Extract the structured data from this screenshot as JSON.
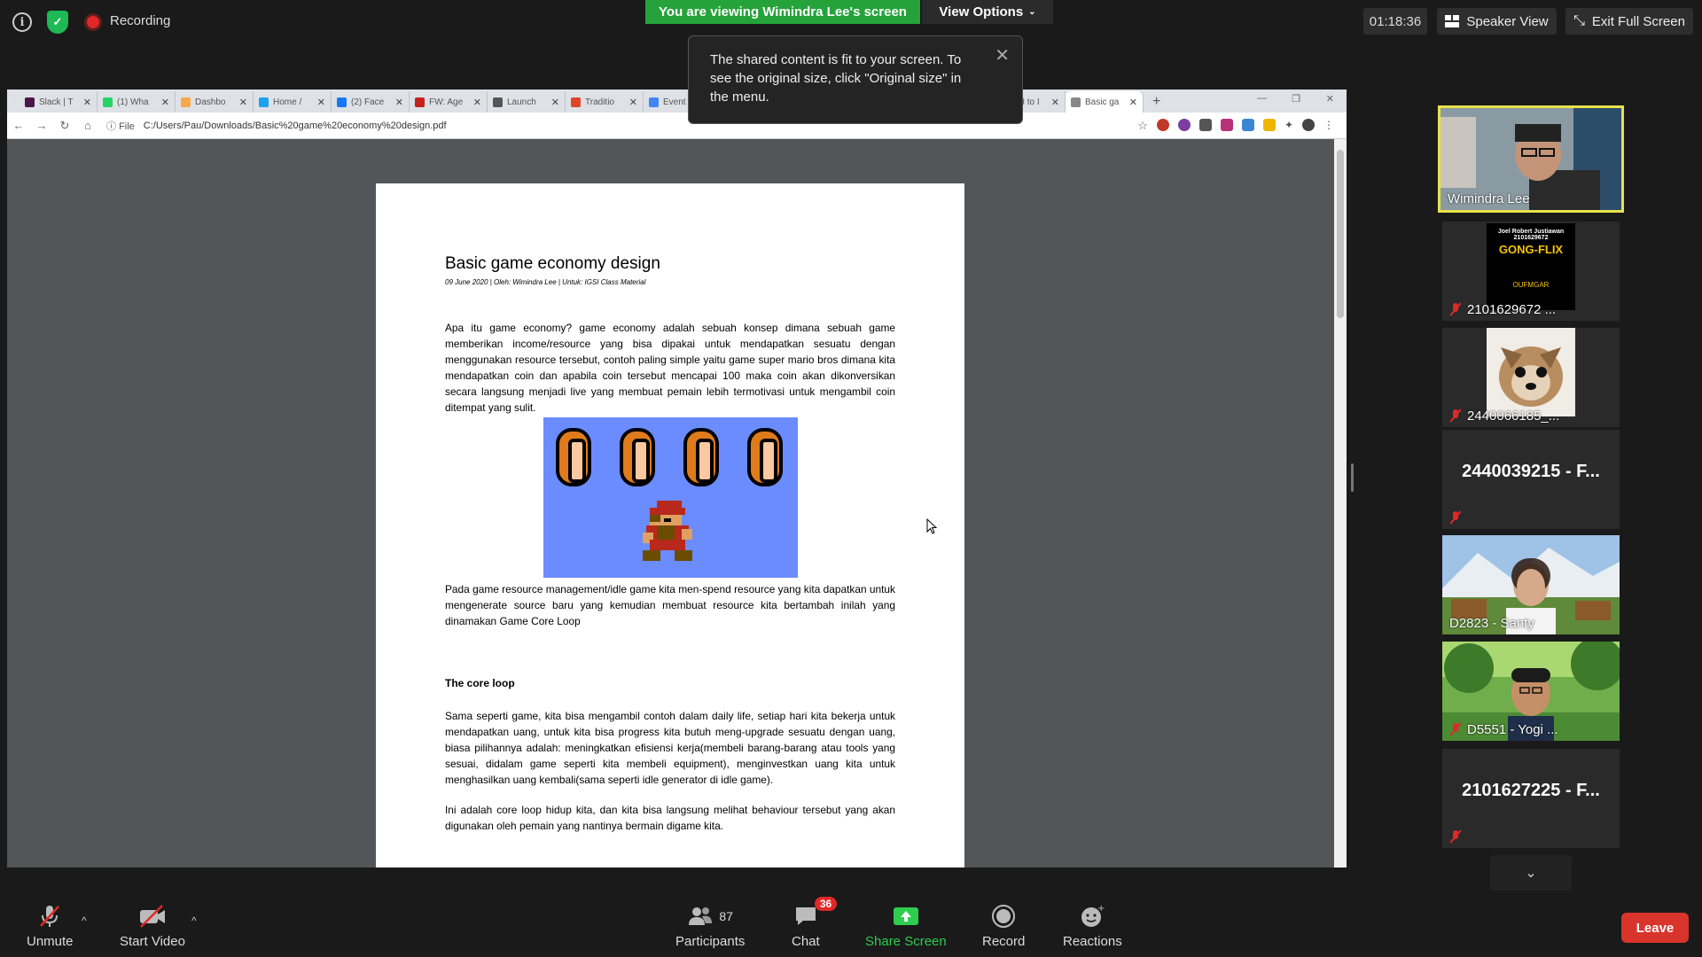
{
  "topbar": {
    "recording_label": "Recording",
    "viewing_banner": "You are viewing Wimindra Lee's screen",
    "view_options_label": "View Options",
    "timer": "01:18:36",
    "speaker_view_label": "Speaker View",
    "exit_fullscreen_label": "Exit Full Screen"
  },
  "tooltip": {
    "text": "The shared content is fit to your screen. To see the original size, click \"Original size\" in the menu."
  },
  "browser": {
    "tabs": [
      {
        "label": "Slack | T",
        "color": "#4a154b"
      },
      {
        "label": "(1) Wha",
        "color": "#25d366"
      },
      {
        "label": "Dashbo",
        "color": "#f7a94a"
      },
      {
        "label": "Home /",
        "color": "#1da1f2"
      },
      {
        "label": "(2) Face",
        "color": "#1877f2"
      },
      {
        "label": "FW: Age",
        "color": "#c5221f"
      },
      {
        "label": "Launch",
        "color": "#555555"
      },
      {
        "label": "Traditio",
        "color": "#e0452b"
      },
      {
        "label": "Event",
        "color": "#4285f4"
      },
      {
        "label": "ETH to I",
        "color": "#2c6ecb"
      },
      {
        "label": "Basic ga",
        "color": "#888888"
      }
    ],
    "address_scheme": "File",
    "address_url": "C:/Users/Pau/Downloads/Basic%20game%20economy%20design.pdf"
  },
  "document": {
    "title": "Basic game economy design",
    "meta": "09 June 2020 | Oleh: Wimindra Lee | Untuk: IGSI Class Material",
    "para1": "Apa itu game economy? game economy adalah sebuah konsep dimana sebuah game memberikan income/resource yang bisa dipakai untuk mendapatkan sesuatu dengan menggunakan resource tersebut, contoh paling simple yaitu game super mario bros dimana kita mendapatkan coin dan apabila coin tersebut mencapai 100 maka coin akan dikonversikan secara langsung menjadi live yang membuat pemain lebih termotivasi untuk mengambil coin ditempat yang sulit.",
    "para2": "Pada game resource management/idle game kita men-spend resource yang kita dapatkan untuk mengenerate source baru yang kemudian membuat resource kita bertambah inilah yang dinamakan Game Core Loop",
    "heading_core_loop": "The core loop",
    "para3": "Sama seperti game, kita bisa mengambil contoh dalam daily life, setiap hari kita bekerja untuk mendapatkan uang, untuk kita bisa progress kita butuh meng-upgrade sesuatu dengan uang, biasa pilihannya adalah: meningkatkan efisiensi kerja(membeli barang-barang atau tools yang sesuai, didalam game seperti kita membeli equipment), menginvestkan uang kita untuk menghasilkan uang kembali(sama seperti idle generator di idle game).",
    "para4": "Ini adalah core loop hidup kita, dan kita bisa langsung melihat behaviour tersebut yang akan digunakan oleh pemain yang nantinya bermain digame kita."
  },
  "gallery": {
    "tiles": [
      {
        "name": "Wimindra Lee",
        "type": "video",
        "muted": false,
        "active": true
      },
      {
        "name": "2101629672 ...",
        "type": "image",
        "muted": true
      },
      {
        "name": "2440066185_...",
        "type": "image",
        "muted": true
      },
      {
        "name": "2440039215 - F...",
        "type": "name",
        "muted": true
      },
      {
        "name": "D2823 - Santy",
        "type": "video",
        "muted": false
      },
      {
        "name": "D5551 - Yogi ...",
        "type": "video",
        "muted": true
      },
      {
        "name": "2101627225 - F...",
        "type": "name",
        "muted": true
      }
    ],
    "poster_name": "Joel Robert Justiawan",
    "poster_id": "2101629672",
    "poster_logo": "GONG-FLIX",
    "poster_footer": "OUFMGAR"
  },
  "toolbar": {
    "unmute_label": "Unmute",
    "start_video_label": "Start Video",
    "participants_label": "Participants",
    "participants_count": "87",
    "chat_label": "Chat",
    "chat_badge": "36",
    "share_screen_label": "Share Screen",
    "record_label": "Record",
    "reactions_label": "Reactions",
    "leave_label": "Leave"
  }
}
